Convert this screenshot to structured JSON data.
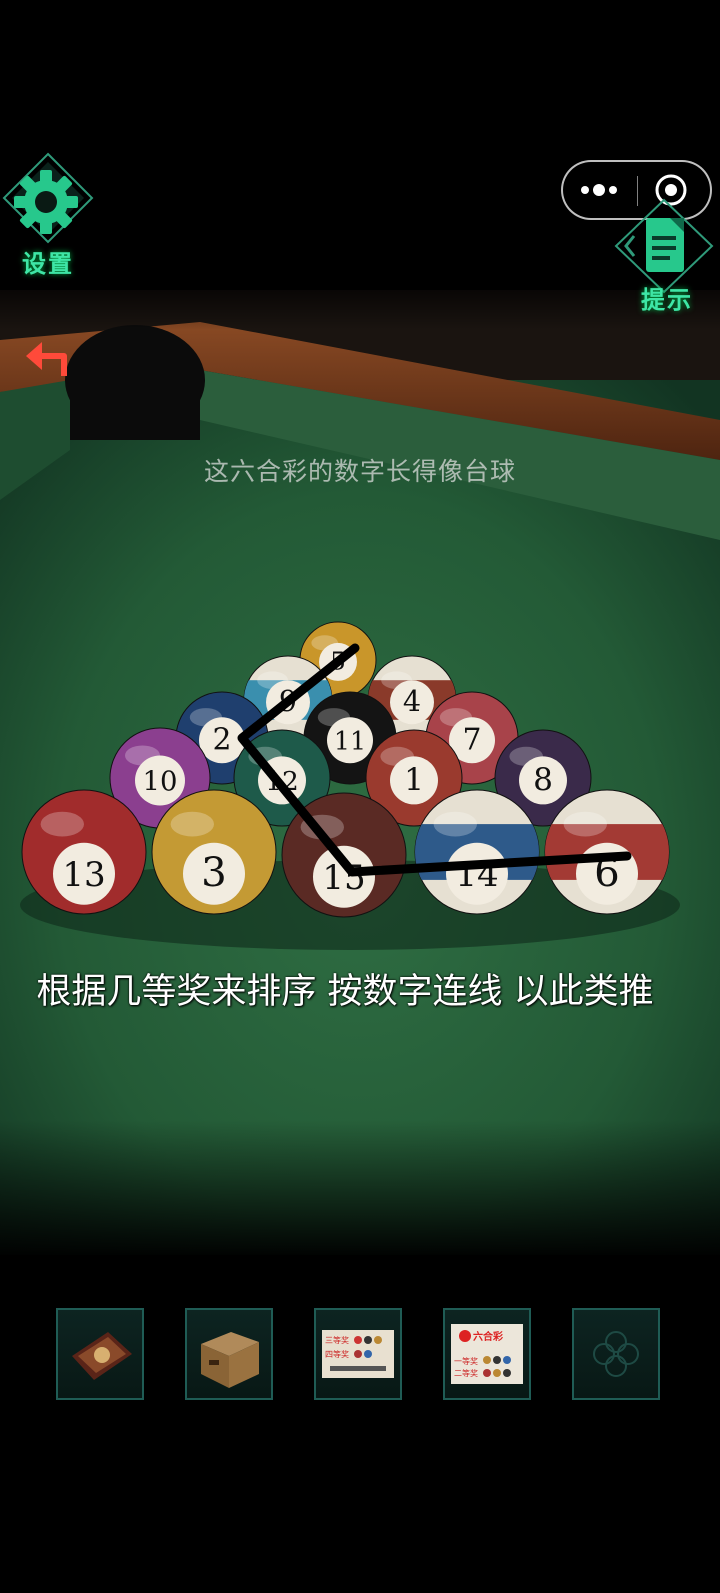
{
  "header": {
    "settings_label": "设置",
    "hint_label": "提示"
  },
  "scene": {
    "caption": "这六合彩的数字长得像台球",
    "clue": "根据几等奖来排序 按数字连线 以此类推"
  },
  "balls": [
    {
      "number": "5",
      "color": "#c9962a",
      "stripe": false
    },
    {
      "number": "9",
      "color": "#3a8fae",
      "stripe": true
    },
    {
      "number": "4",
      "color": "#8a3a2a",
      "stripe": true
    },
    {
      "number": "2",
      "color": "#1f3f6e",
      "stripe": false
    },
    {
      "number": "11",
      "color": "#141414",
      "stripe": false
    },
    {
      "number": "7",
      "color": "#a8434a",
      "stripe": false
    },
    {
      "number": "10",
      "color": "#8b3f8f",
      "stripe": false
    },
    {
      "number": "12",
      "color": "#1e5a4a",
      "stripe": false
    },
    {
      "number": "1",
      "color": "#9a3a2e",
      "stripe": false
    },
    {
      "number": "8",
      "color": "#3a2a4a",
      "stripe": false
    },
    {
      "number": "13",
      "color": "#a12c2c",
      "stripe": false
    },
    {
      "number": "3",
      "color": "#c49a34",
      "stripe": false
    },
    {
      "number": "15",
      "color": "#5a2a24",
      "stripe": false
    },
    {
      "number": "14",
      "color": "#2e5a8a",
      "stripe": true
    },
    {
      "number": "6",
      "color": "#a33a34",
      "stripe": true
    }
  ],
  "drawn_path": [
    "5",
    "2",
    "15",
    "6"
  ],
  "inventory": {
    "items": [
      {
        "name": "box-lid-art",
        "label": ""
      },
      {
        "name": "cardboard-box",
        "label": ""
      },
      {
        "name": "lottery-ticket-prizes",
        "label": "三等奖",
        "label2": "四等奖"
      },
      {
        "name": "lottery-ticket-liuhecai",
        "label": "六合彩",
        "label2": "一等奖",
        "label3": "二等奖"
      },
      {
        "name": "empty-slot",
        "label": ""
      }
    ]
  }
}
